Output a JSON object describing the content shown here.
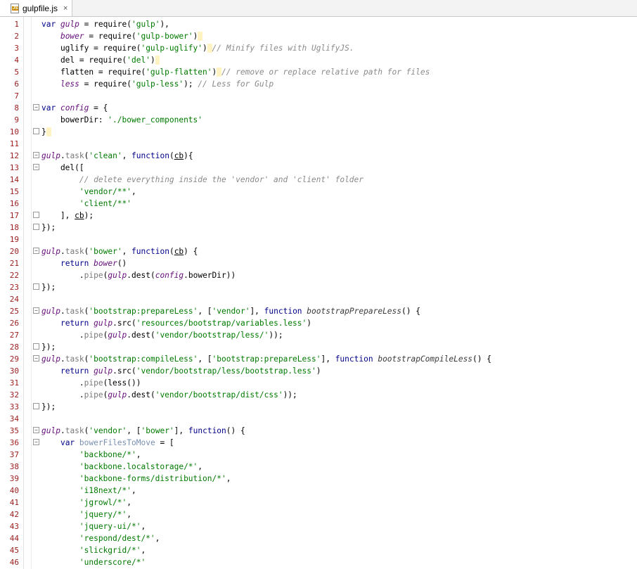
{
  "tab": {
    "label": "gulpfile.js",
    "close": "×",
    "icon_text": "JS"
  },
  "lines": [
    {
      "n": "1",
      "html": "<span class=\"kw\">var</span> <span class=\"var\">gulp</span> = require(<span class=\"str\">'gulp'</span>),"
    },
    {
      "n": "2",
      "html": "    <span class=\"var\">bower</span> = require(<span class=\"str\">'gulp-bower'</span>)<span class=\"hl\"> </span>"
    },
    {
      "n": "3",
      "html": "    uglify = require(<span class=\"str\">'gulp-uglify'</span>)<span class=\"hl\"> </span><span class=\"cm\">// Minify files with UglifyJS.</span>"
    },
    {
      "n": "4",
      "html": "    del = require(<span class=\"str\">'del'</span>)<span class=\"hl\"> </span>"
    },
    {
      "n": "5",
      "html": "    flatten = require(<span class=\"str\">'gulp-flatten'</span>)<span class=\"hl\"> </span><span class=\"cm\">// remove or replace relative path for files</span>"
    },
    {
      "n": "6",
      "html": "    <span class=\"var\">less</span> = require(<span class=\"str\">'gulp-less'</span>); <span class=\"cm\">// Less for Gulp</span>"
    },
    {
      "n": "7",
      "html": ""
    },
    {
      "n": "8",
      "html": "<span class=\"kw\">var</span> <span class=\"var\">config</span> = {",
      "fold": "-"
    },
    {
      "n": "9",
      "html": "    bowerDir: <span class=\"str\">'./bower_components'</span>"
    },
    {
      "n": "10",
      "html": "}<span class=\"hl\"> </span>",
      "fold": "^"
    },
    {
      "n": "11",
      "html": ""
    },
    {
      "n": "12",
      "html": "<span class=\"var\">gulp</span>.<span class=\"prop\">task</span>(<span class=\"str\">'clean'</span>, <span class=\"kw\">function</span>(<span class=\"ul\">cb</span>){",
      "fold": "-"
    },
    {
      "n": "13",
      "html": "    del([",
      "fold": "-"
    },
    {
      "n": "14",
      "html": "        <span class=\"cm\">// delete everything inside the 'vendor' and 'client' folder</span>"
    },
    {
      "n": "15",
      "html": "        <span class=\"str\">'vendor/**'</span>,"
    },
    {
      "n": "16",
      "html": "        <span class=\"str\">'client/**'</span>"
    },
    {
      "n": "17",
      "html": "    ], <span class=\"ul\">cb</span>);",
      "fold": "^"
    },
    {
      "n": "18",
      "html": "});",
      "fold": "^"
    },
    {
      "n": "19",
      "html": ""
    },
    {
      "n": "20",
      "html": "<span class=\"var\">gulp</span>.<span class=\"prop\">task</span>(<span class=\"str\">'bower'</span>, <span class=\"kw\">function</span>(<span class=\"ul\">cb</span>) {",
      "fold": "-"
    },
    {
      "n": "21",
      "html": "    <span class=\"kw\">return</span> <span class=\"var\">bower</span>()"
    },
    {
      "n": "22",
      "html": "        .<span class=\"prop\">pipe</span>(<span class=\"var\">gulp</span>.dest(<span class=\"var\">config</span>.bowerDir))"
    },
    {
      "n": "23",
      "html": "});",
      "fold": "^"
    },
    {
      "n": "24",
      "html": ""
    },
    {
      "n": "25",
      "html": "<span class=\"var\">gulp</span>.<span class=\"prop\">task</span>(<span class=\"str\">'bootstrap:prepareLess'</span>, [<span class=\"str\">'vendor'</span>], <span class=\"kw\">function</span> <span class=\"it\">bootstrapPrepareLess</span>() {",
      "fold": "-"
    },
    {
      "n": "26",
      "html": "    <span class=\"kw\">return</span> <span class=\"var\">gulp</span>.src(<span class=\"str\">'resources/bootstrap/variables.less'</span>)"
    },
    {
      "n": "27",
      "html": "        .<span class=\"prop\">pipe</span>(<span class=\"var\">gulp</span>.dest(<span class=\"str\">'vendor/bootstrap/less/'</span>));"
    },
    {
      "n": "28",
      "html": "});",
      "fold": "^"
    },
    {
      "n": "29",
      "html": "<span class=\"var\">gulp</span>.<span class=\"prop\">task</span>(<span class=\"str\">'bootstrap:compileLess'</span>, [<span class=\"str\">'bootstrap:prepareLess'</span>], <span class=\"kw\">function</span> <span class=\"it\">bootstrapCompileLess</span>() {",
      "fold": "-"
    },
    {
      "n": "30",
      "html": "    <span class=\"kw\">return</span> <span class=\"var\">gulp</span>.src(<span class=\"str\">'vendor/bootstrap/less/bootstrap.less'</span>)"
    },
    {
      "n": "31",
      "html": "        .<span class=\"prop\">pipe</span>(less())"
    },
    {
      "n": "32",
      "html": "        .<span class=\"prop\">pipe</span>(<span class=\"var\">gulp</span>.dest(<span class=\"str\">'vendor/bootstrap/dist/css'</span>));"
    },
    {
      "n": "33",
      "html": "});",
      "fold": "^"
    },
    {
      "n": "34",
      "html": ""
    },
    {
      "n": "35",
      "html": "<span class=\"var\">gulp</span>.<span class=\"prop\">task</span>(<span class=\"str\">'vendor'</span>, [<span class=\"str\">'bower'</span>], <span class=\"kw\">function</span>() {",
      "fold": "-"
    },
    {
      "n": "36",
      "html": "    <span class=\"kw\">var</span> <span class=\"fn\" style=\"color:#7a8fb0\">bowerFilesToMove</span> = [",
      "fold": "-"
    },
    {
      "n": "37",
      "html": "        <span class=\"str\">'backbone/*'</span>,"
    },
    {
      "n": "38",
      "html": "        <span class=\"str\">'backbone.localstorage/*'</span>,"
    },
    {
      "n": "39",
      "html": "        <span class=\"str\">'backbone-forms/distribution/*'</span>,"
    },
    {
      "n": "40",
      "html": "        <span class=\"str\">'i18next/*'</span>,"
    },
    {
      "n": "41",
      "html": "        <span class=\"str\">'jgrowl/*'</span>,"
    },
    {
      "n": "42",
      "html": "        <span class=\"str\">'jquery/*'</span>,"
    },
    {
      "n": "43",
      "html": "        <span class=\"str\">'jquery-ui/*'</span>,"
    },
    {
      "n": "44",
      "html": "        <span class=\"str\">'respond/dest/*'</span>,"
    },
    {
      "n": "45",
      "html": "        <span class=\"str\">'slickgrid/*'</span>,"
    },
    {
      "n": "46",
      "html": "        <span class=\"str\">'underscore/*'</span>"
    }
  ]
}
